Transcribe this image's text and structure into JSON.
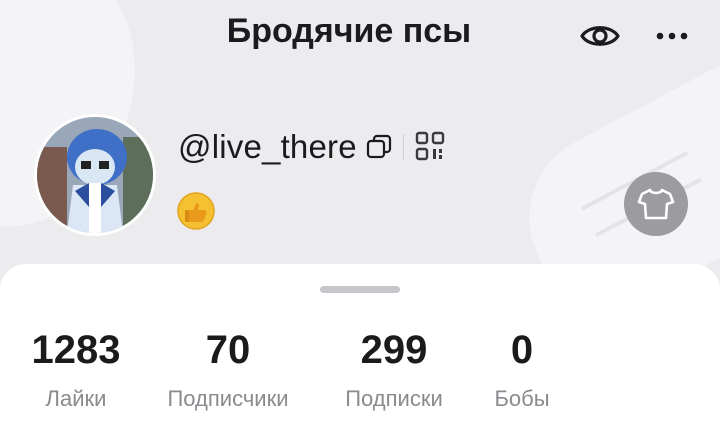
{
  "header": {
    "title": "Бродячие псы"
  },
  "profile": {
    "username": "@live_there"
  },
  "stats": [
    {
      "value": "1283",
      "label": "Лайки"
    },
    {
      "value": "70",
      "label": "Подписчики"
    },
    {
      "value": "299",
      "label": "Подписки"
    },
    {
      "value": "0",
      "label": "Бобы"
    }
  ],
  "icons": {
    "view": "eye-icon",
    "more": "more-dots-icon",
    "copy": "copy-icon",
    "qr": "qr-code-icon",
    "badge": "thumbs-up-emoji-icon",
    "outfit": "tshirt-icon"
  },
  "colors": {
    "background": "#ececee",
    "sheet": "#ffffff",
    "text_primary": "#1b1b1d",
    "text_secondary": "#8a8a8f",
    "tshirt_button": "#9b9ba0"
  }
}
